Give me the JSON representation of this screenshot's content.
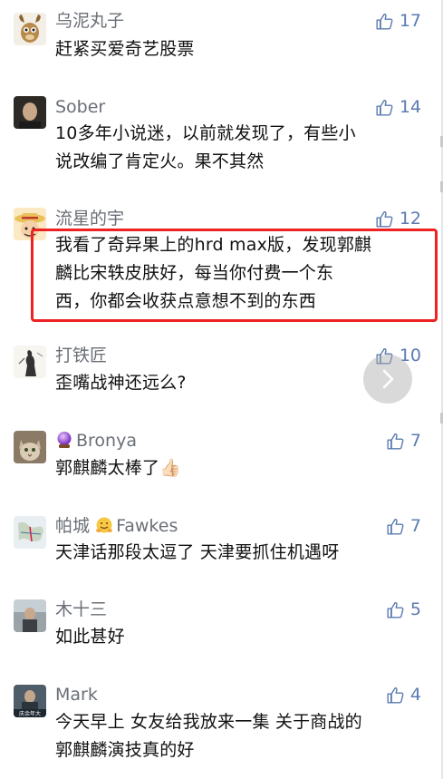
{
  "comments": [
    {
      "username": "乌泥丸子",
      "likes": "17",
      "text": "赶紧买爱奇艺股票",
      "avatar_icon": "cartoon-goat-avatar"
    },
    {
      "username": "Sober",
      "likes": "14",
      "text": "10多年小说迷，以前就发现了，有些小\n说改编了肯定火。果不其然",
      "avatar_icon": "portrait-photo-avatar"
    },
    {
      "username": "流星的宇",
      "likes": "12",
      "text": "我看了奇异果上的hrd max版，发现郭麒\n麟比宋轶皮肤好，每当你付费一个东\n西，你都会收获点意想不到的东西",
      "avatar_icon": "straw-hat-pirate-avatar"
    },
    {
      "username": "打铁匠",
      "likes": "10",
      "text": "歪嘴战神还远么?",
      "avatar_icon": "ink-figure-avatar"
    },
    {
      "username": "Bronya",
      "username_emoji": "crystal-ball-icon",
      "likes": "7",
      "text": "郭麒麟太棒了👍🏻",
      "avatar_icon": "cat-photo-avatar"
    },
    {
      "username": "帕城",
      "username_suffix": "Fawkes",
      "username_emoji": "hugging-face-icon",
      "likes": "7",
      "text": "天津话那段太逗了 天津要抓住机遇呀",
      "avatar_icon": "map-avatar"
    },
    {
      "username": "木十三",
      "likes": "5",
      "text": "如此甚好",
      "avatar_icon": "street-photo-avatar"
    },
    {
      "username": "Mark",
      "likes": "4",
      "text": "今天早上 女友给我放来一集 关于商战的\n郭麒麟演技真的好",
      "avatar_icon": "movie-poster-avatar",
      "avatar_caption": "庆余年大"
    }
  ],
  "colors": {
    "username": "#6a6f76",
    "like": "#5b7bb0",
    "text": "#111111",
    "highlight": "#ee2222"
  },
  "icons": {
    "like": "thumbs-up-icon",
    "next": "chevron-right-icon"
  }
}
